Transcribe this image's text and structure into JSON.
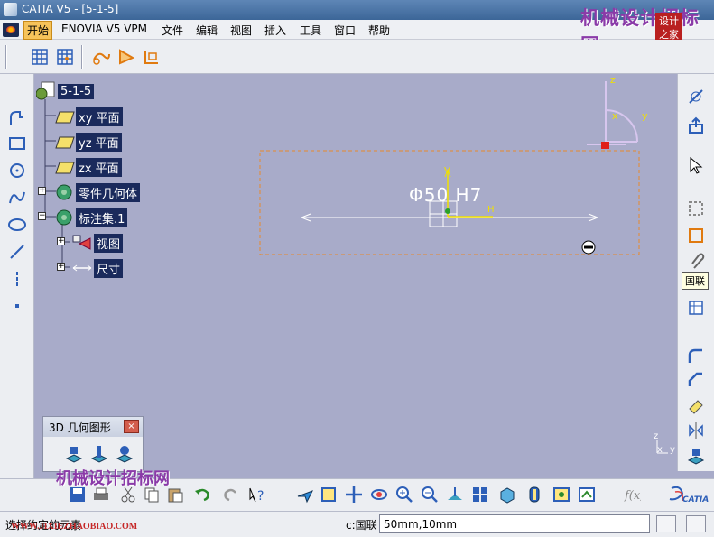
{
  "window": {
    "title": "CATIA V5 - [5-1-5]"
  },
  "menu": [
    "开始",
    "ENOVIA V5 VPM",
    "文件",
    "编辑",
    "视图",
    "插入",
    "工具",
    "窗口",
    "帮助"
  ],
  "watermark": {
    "text": "机械设计招标网",
    "url": "WWW.JIXIEZHAOBIAO.COM",
    "seal": "设计之家"
  },
  "tree": {
    "root": "5-1-5",
    "items": [
      "xy 平面",
      "yz 平面",
      "zx 平面",
      "零件几何体",
      "标注集.1",
      "视图",
      "尺寸"
    ]
  },
  "viewport": {
    "dimension_text": "Φ50 H7",
    "axis_labels": {
      "z": "z",
      "x": "x",
      "y": "y",
      "h": "H",
      "v": "V"
    },
    "mini_axis": {
      "z": "z",
      "x": "x",
      "y": "y"
    }
  },
  "tooltip": "国联",
  "panel3d": {
    "title": "3D 几何图形",
    "close": "×"
  },
  "status": {
    "left_text": "选择约定的元素",
    "prompt": "c:国联",
    "input_value": "50mm,10mm"
  },
  "brand": {
    "catia": "CATIA"
  },
  "colors": {
    "tree_label_bg": "#1a2a5c",
    "viewport_bg": "#a8abc9",
    "dashed_box": "#e88a2a",
    "dim_line": "#ffffff",
    "axis_yellow": "#f0e000"
  }
}
